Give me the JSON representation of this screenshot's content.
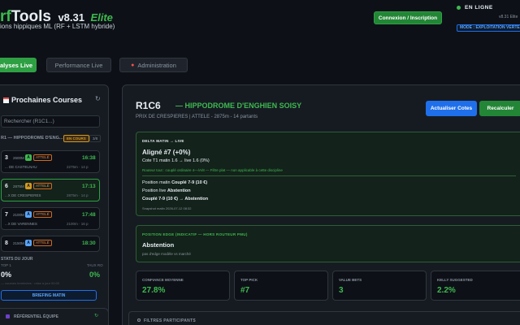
{
  "header": {
    "brand_prefix": "rf",
    "brand_suffix": "Tools",
    "version": "v8.31",
    "edition": "Elite",
    "subtitle": "ions hippiques ML (RF + LSTM hybride)",
    "login_label": "Connexion / Inscription",
    "status_label": "EN LIGNE",
    "version_small": "v8.31 Elite",
    "mode_label": "MODE : EXPLOITATION VERTE"
  },
  "tabs": [
    {
      "label": "alyses Live",
      "active": true
    },
    {
      "label": "Performance Live",
      "active": false
    },
    {
      "label": "Administration",
      "active": false
    }
  ],
  "sidebar": {
    "title": "Prochaines Courses",
    "search_placeholder": "Rechercher (R1C1...)",
    "meeting_label": "R1 — HIPPODROME D'ENG...",
    "meeting_badge": "EN COURS",
    "meeting_count": "3/8",
    "races": [
      {
        "num": "3",
        "km": "2600M",
        "disc": "A",
        "cat": "ATTELÉ",
        "time": "16:38",
        "name": "... DE CASTELNAU",
        "meta": "2275m · 14 p"
      },
      {
        "num": "6",
        "km": "2875M",
        "disc": "A",
        "cat": "ATTELÉ",
        "time": "17:13",
        "name": "...X DE CRESPIERES",
        "meta": "2875m · 14 p"
      },
      {
        "num": "7",
        "km": "2100M",
        "disc": "A",
        "cat": "ATTELÉ",
        "time": "17:48",
        "name": "...X DE VARENNES",
        "meta": "2100m · 16 p"
      },
      {
        "num": "8",
        "km": "2150M",
        "disc": "A",
        "cat": "ATTELÉ",
        "time": "18:30",
        "name": "",
        "meta": ""
      }
    ],
    "stats": {
      "title": "STATS DU JOUR",
      "left_sub": "TOP 1",
      "right_sub": "TAUX RO",
      "left_value": "0%",
      "right_value": "0%",
      "note": "— courses terminées · mise à jour 00:00"
    },
    "briefing_label": "BRIEFING MATIN",
    "reference_label": "RÉFÉRENTIEL ÉQUIPE"
  },
  "main": {
    "race_code": "R1C6",
    "hippodrome": "— HIPPODROME D'ENGHIEN SOISY",
    "race_info": "PRIX DE CRESPIERES | ATTELE - 2875m - 14 partants",
    "update_odds_label": "Actualiser Cotes",
    "recalc_label": "Recalculer",
    "delta": {
      "header": "DELTA MATIN → LIVE",
      "headline": "Aligné #7 (+0%)",
      "cote_line": "Cote T1 matin 1.6 → live 1.6 (0%)",
      "router_line": "Routeur tout : couplé ordinaire 4—/A/8 — Filtre plat — non applicable à cette discipline",
      "position_matin_label": "Position matin",
      "position_matin_value": "Couplé 7-9 (10 €)",
      "position_live_label": "Position live",
      "position_live_value": "Abstention",
      "couple_line": "Couplé 7-9 (10 €) → Abstention",
      "snapshot": "Snapshot matin 2026-07-12 08:32"
    },
    "edge": {
      "header": "POSITION EDGE (INDICATIF — HORS ROUTEUR PMU)",
      "headline": "Abstention",
      "sub": "pas d'edge modèle vs marché"
    },
    "stat_cards": [
      {
        "label": "CONFIANCE MOYENNE",
        "value": "27.8%"
      },
      {
        "label": "TOP PICK",
        "value": "#7"
      },
      {
        "label": "VALUE BETS",
        "value": "3"
      },
      {
        "label": "KELLY SUGGESTED",
        "value": "2.2%"
      }
    ],
    "filters_label": "FILTRES PARTICIPANTS"
  },
  "colors": {
    "accent_green": "#3fb950",
    "accent_blue": "#1f6feb",
    "panel_bg": "#161b22",
    "page_bg": "#0d1117",
    "warning_orange": "#d29922"
  }
}
